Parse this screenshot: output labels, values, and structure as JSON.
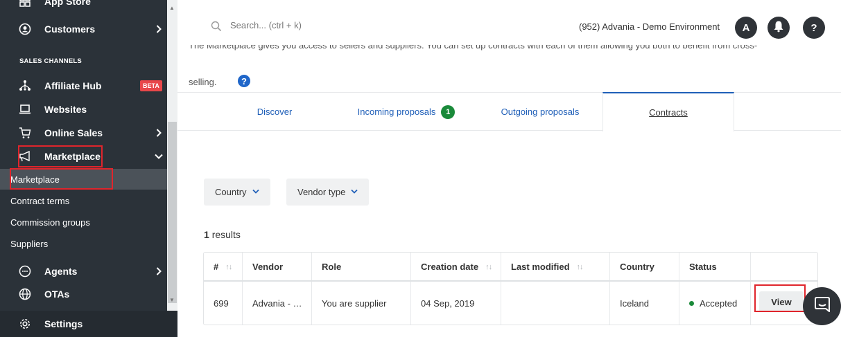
{
  "sidebar": {
    "top_item": "App Store",
    "customers": "Customers",
    "section_sales_channels": "SALES CHANNELS",
    "affiliate_hub": "Affiliate Hub",
    "beta": "BETA",
    "websites": "Websites",
    "online_sales": "Online Sales",
    "marketplace": "Marketplace",
    "submenu": [
      "Marketplace",
      "Contract terms",
      "Commission groups",
      "Suppliers"
    ],
    "agents": "Agents",
    "otas": "OTAs",
    "settings": "Settings"
  },
  "search": {
    "placeholder": "Search... (ctrl + k)"
  },
  "header": {
    "environment": "(952) Advania - Demo Environment",
    "avatar_initial": "A",
    "help_label": "?"
  },
  "intro": {
    "line1": "The Marketplace gives you access to sellers and suppliers. You can set up contracts with each of them allowing you both to benefit from cross-",
    "line2": "selling.",
    "help": "?"
  },
  "tabs": [
    {
      "label": "Discover"
    },
    {
      "label": "Incoming proposals",
      "badge": "1"
    },
    {
      "label": "Outgoing proposals"
    },
    {
      "label": "Contracts",
      "active": true
    }
  ],
  "filters": {
    "country": "Country",
    "vendor_type": "Vendor type"
  },
  "results": {
    "count": "1",
    "label": "results"
  },
  "table": {
    "columns": [
      "#",
      "Vendor",
      "Role",
      "Creation date",
      "Last modified",
      "Country",
      "Status"
    ],
    "rows": [
      {
        "id": "699",
        "vendor": "Advania - …",
        "role": "You are supplier",
        "creation_date": "04 Sep, 2019",
        "last_modified": "",
        "country": "Iceland",
        "status": "Accepted",
        "action": "View"
      }
    ]
  },
  "colors": {
    "sidebar_bg": "#2b3239",
    "accent_blue": "#1f5fb8",
    "badge_green": "#1a8a3a",
    "highlight_red": "#e0252c"
  }
}
